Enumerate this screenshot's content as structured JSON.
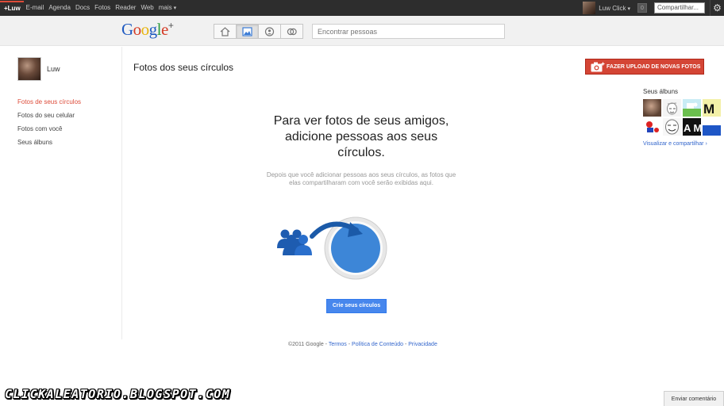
{
  "topbar": {
    "nav": [
      "+Luw",
      "E-mail",
      "Agenda",
      "Docs",
      "Fotos",
      "Reader",
      "Web",
      "mais"
    ],
    "user_name": "Luw Click",
    "notifications": "0",
    "share_label": "Compartilhar..."
  },
  "header": {
    "logo": "Google+",
    "search_placeholder": "Encontrar pessoas"
  },
  "sidebar": {
    "profile_name": "Luw",
    "items": [
      {
        "label": "Fotos de seus círculos",
        "active": true
      },
      {
        "label": "Fotos do seu celular"
      },
      {
        "label": "Fotos com você"
      },
      {
        "label": "Seus álbuns"
      }
    ]
  },
  "main": {
    "title": "Fotos dos seus círculos",
    "upload_label": "FAZER UPLOAD DE NOVAS FOTOS",
    "headline": "Para ver fotos de seus amigos, adicione pessoas aos seus círculos.",
    "subtext": "Depois que você adicionar pessoas aos seus círculos, as fotos que elas compartilharam com você serão exibidas aqui.",
    "create_label": "Crie seus círculos"
  },
  "albums": {
    "title": "Seus álbuns",
    "link": "Visualizar e compartilhar ›"
  },
  "footer": {
    "copyright": "©2011 Google -",
    "links": [
      "Termos",
      "Política de Conteúdo",
      "Privacidade"
    ]
  },
  "watermark": "CLICKALEATORIO.BLOGSPOT.COM",
  "feedback_label": "Enviar comentário",
  "colors": {
    "accent_red": "#dd4b39",
    "upload_red": "#d44535",
    "blue_button": "#4787ed",
    "link_blue": "#3366cc"
  }
}
